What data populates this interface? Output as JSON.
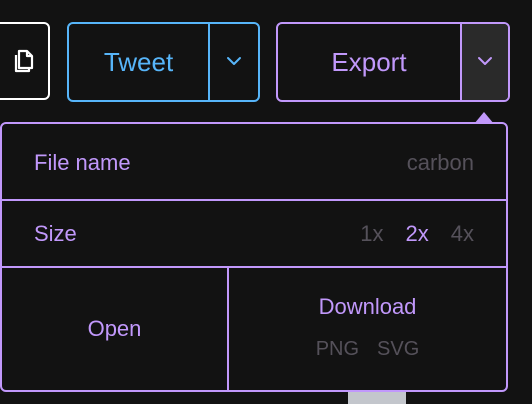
{
  "toolbar": {
    "copy_icon": "copy-icon",
    "tweet_label": "Tweet",
    "tweet_dropdown_icon": "chevron-down-icon",
    "export_label": "Export",
    "export_dropdown_icon": "chevron-down-icon"
  },
  "export_menu": {
    "file_name": {
      "label": "File name",
      "placeholder": "carbon",
      "value": ""
    },
    "size": {
      "label": "Size",
      "options": [
        "1x",
        "2x",
        "4x"
      ],
      "selected": "2x"
    },
    "open_label": "Open",
    "download": {
      "label": "Download",
      "formats": [
        "PNG",
        "SVG"
      ]
    }
  },
  "colors": {
    "background": "#121212",
    "tweet_accent": "#57b5f9",
    "export_accent": "#c198fb",
    "muted": "#55515a",
    "white": "#ffffff"
  }
}
